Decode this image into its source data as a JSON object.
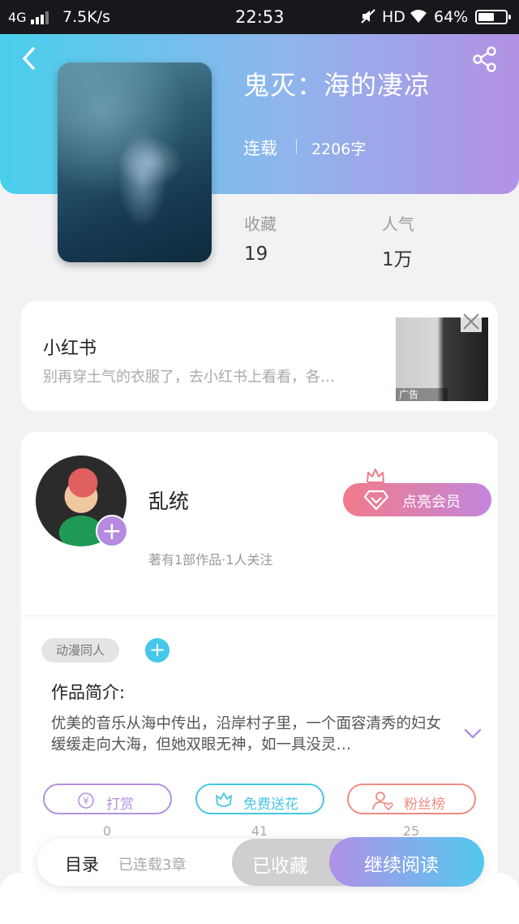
{
  "status_bar": {
    "network": "4G",
    "speed": "7.5K/s",
    "time": "22:53",
    "carrier": "HD",
    "battery_percent": "64%",
    "battery_level": 0.64
  },
  "header": {
    "title": "鬼灭：海的凄凉",
    "serial_status": "连载",
    "word_count": "2206字"
  },
  "stats": [
    {
      "label": "收藏",
      "value": "19"
    },
    {
      "label": "人气",
      "value": "1万"
    }
  ],
  "ad": {
    "title": "小红书",
    "description": "别再穿土气的衣服了，去小红书上看看，各…",
    "tag": "广告"
  },
  "author": {
    "name": "乱统",
    "meta": "著有1部作品·1人关注",
    "vip_label": "点亮会员"
  },
  "work": {
    "tag": "动漫同人",
    "intro_label": "作品简介:",
    "intro_text": "优美的音乐从海中传出，沿岸村子里，一个面容清秀的妇女缓缓走向大海，但她双眼无神，如一具没灵…"
  },
  "actions": [
    {
      "label": "打赏",
      "count": "0",
      "color": "#b291e0"
    },
    {
      "label": "免费送花",
      "count": "41",
      "color": "#48c6e4"
    },
    {
      "label": "粉丝榜",
      "count": "25",
      "color": "#ef8c83"
    }
  ],
  "bottom_bar": {
    "toc_label": "目录",
    "toc_count": "已连载3章",
    "collected_label": "已收藏",
    "read_label": "继续阅读"
  },
  "colors": {
    "accent_blue": "#49cfec",
    "accent_purple": "#b391e4"
  }
}
